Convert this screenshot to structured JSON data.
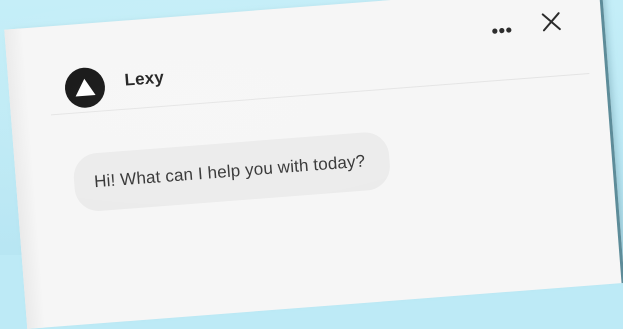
{
  "chat": {
    "bot_name": "Lexy",
    "messages": [
      {
        "sender": "bot",
        "text": "Hi! What can I help you with today?"
      }
    ]
  },
  "header": {
    "more_icon": "more-horizontal-icon",
    "close_icon": "close-icon",
    "avatar_icon": "triangle-logo-icon"
  },
  "colors": {
    "background": "#bdeaf6",
    "panel": "#f6f6f6",
    "bubble": "#ebebeb",
    "avatar": "#0f0f0f",
    "text": "#333333"
  }
}
